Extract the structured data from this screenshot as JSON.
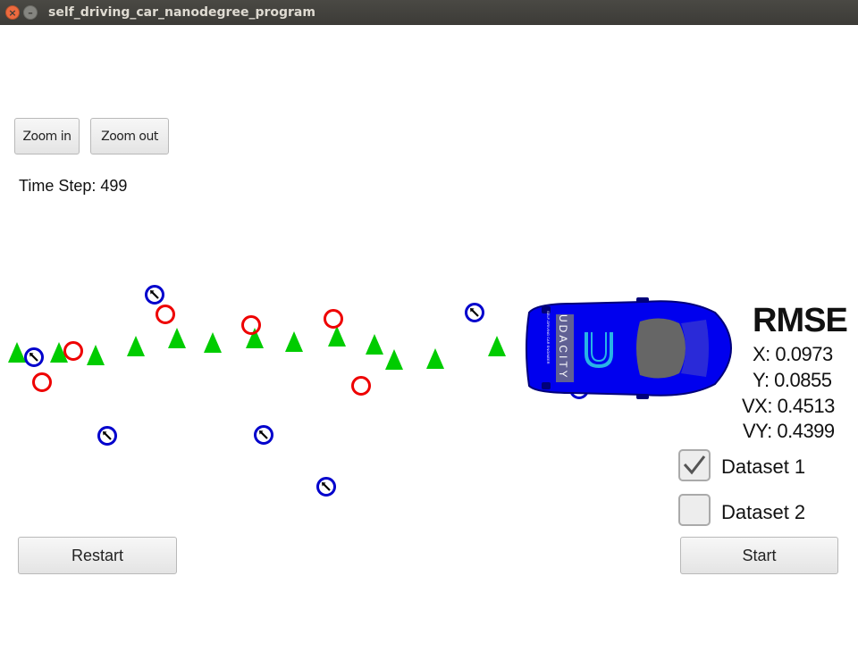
{
  "window": {
    "title": "self_driving_car_nanodegree_program",
    "close_glyph": "×",
    "min_glyph": "–"
  },
  "toolbar": {
    "zoom_in": "Zoom in",
    "zoom_out": "Zoom out"
  },
  "status": {
    "time_step": "Time Step: 499"
  },
  "rmse": {
    "title": "RMSE",
    "x": "X: 0.0973",
    "y": "Y: 0.0855",
    "vx": "VX: 0.4513",
    "vy": "VY: 0.4399"
  },
  "datasets": [
    {
      "label": "Dataset 1",
      "checked": true
    },
    {
      "label": "Dataset 2",
      "checked": false
    }
  ],
  "actions": {
    "restart": "Restart",
    "start": "Start"
  },
  "car": {
    "brand_text": "UDACITY",
    "sub_text": "SELF-DRIVING CAR ENGINEER",
    "color": "#0000ee"
  },
  "colors": {
    "lidar": "#ee0000",
    "radar": "#0000cc",
    "estimate": "#00cc00"
  },
  "legend_icons": {
    "lidar": "red-circle-marker",
    "radar": "blue-circle-arrow-marker",
    "estimate": "green-triangle-marker"
  }
}
